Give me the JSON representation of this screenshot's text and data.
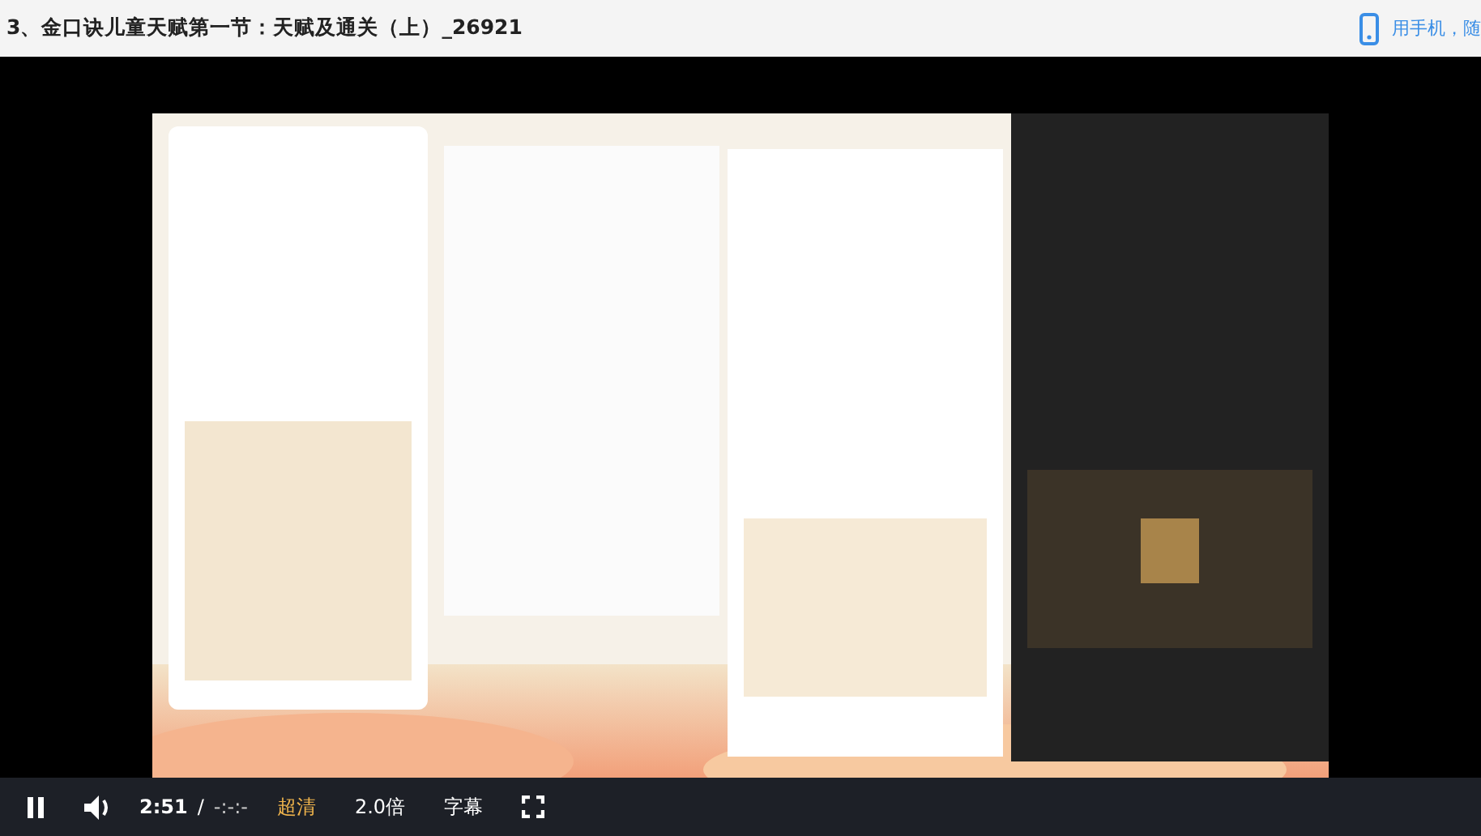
{
  "header": {
    "title": "3、金口诀儿童天赋第一节：天赋及通关（上）_26921",
    "mobile_link": "用手机，随"
  },
  "controls": {
    "playing": true,
    "time_current": "2:51",
    "time_separator": "/",
    "time_total": "-:-:-",
    "buttons": [
      {
        "label": "超清",
        "selected": true
      },
      {
        "label": "2.0倍",
        "selected": false
      },
      {
        "label": "字幕",
        "selected": false
      }
    ]
  }
}
